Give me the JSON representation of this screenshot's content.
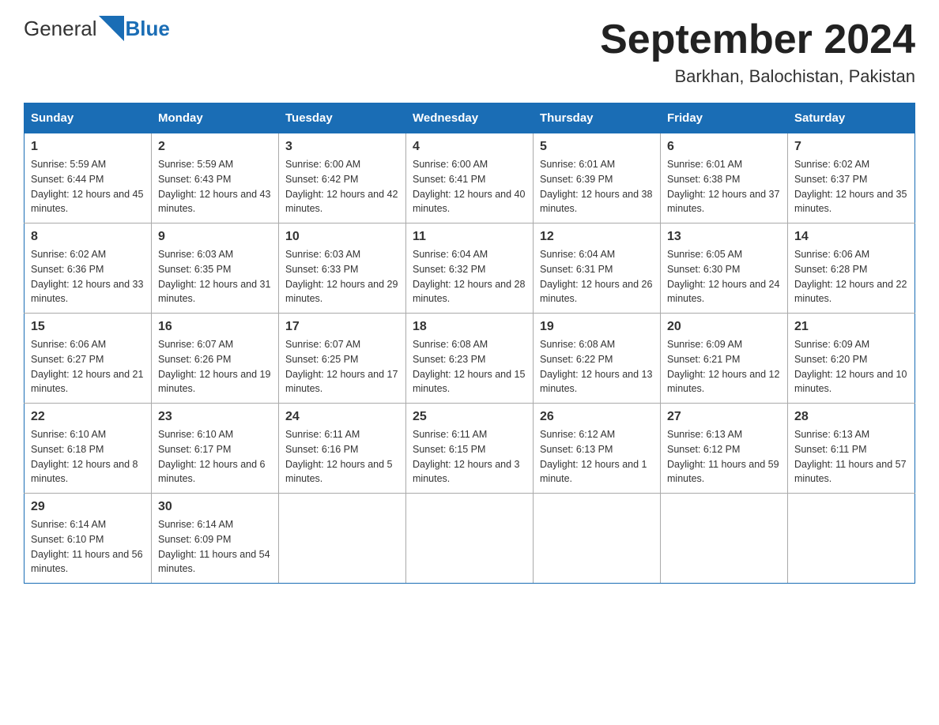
{
  "header": {
    "logo_general": "General",
    "logo_blue": "Blue",
    "month_title": "September 2024",
    "location": "Barkhan, Balochistan, Pakistan"
  },
  "weekdays": [
    "Sunday",
    "Monday",
    "Tuesday",
    "Wednesday",
    "Thursday",
    "Friday",
    "Saturday"
  ],
  "weeks": [
    [
      {
        "day": "1",
        "sunrise": "5:59 AM",
        "sunset": "6:44 PM",
        "daylight": "12 hours and 45 minutes."
      },
      {
        "day": "2",
        "sunrise": "5:59 AM",
        "sunset": "6:43 PM",
        "daylight": "12 hours and 43 minutes."
      },
      {
        "day": "3",
        "sunrise": "6:00 AM",
        "sunset": "6:42 PM",
        "daylight": "12 hours and 42 minutes."
      },
      {
        "day": "4",
        "sunrise": "6:00 AM",
        "sunset": "6:41 PM",
        "daylight": "12 hours and 40 minutes."
      },
      {
        "day": "5",
        "sunrise": "6:01 AM",
        "sunset": "6:39 PM",
        "daylight": "12 hours and 38 minutes."
      },
      {
        "day": "6",
        "sunrise": "6:01 AM",
        "sunset": "6:38 PM",
        "daylight": "12 hours and 37 minutes."
      },
      {
        "day": "7",
        "sunrise": "6:02 AM",
        "sunset": "6:37 PM",
        "daylight": "12 hours and 35 minutes."
      }
    ],
    [
      {
        "day": "8",
        "sunrise": "6:02 AM",
        "sunset": "6:36 PM",
        "daylight": "12 hours and 33 minutes."
      },
      {
        "day": "9",
        "sunrise": "6:03 AM",
        "sunset": "6:35 PM",
        "daylight": "12 hours and 31 minutes."
      },
      {
        "day": "10",
        "sunrise": "6:03 AM",
        "sunset": "6:33 PM",
        "daylight": "12 hours and 29 minutes."
      },
      {
        "day": "11",
        "sunrise": "6:04 AM",
        "sunset": "6:32 PM",
        "daylight": "12 hours and 28 minutes."
      },
      {
        "day": "12",
        "sunrise": "6:04 AM",
        "sunset": "6:31 PM",
        "daylight": "12 hours and 26 minutes."
      },
      {
        "day": "13",
        "sunrise": "6:05 AM",
        "sunset": "6:30 PM",
        "daylight": "12 hours and 24 minutes."
      },
      {
        "day": "14",
        "sunrise": "6:06 AM",
        "sunset": "6:28 PM",
        "daylight": "12 hours and 22 minutes."
      }
    ],
    [
      {
        "day": "15",
        "sunrise": "6:06 AM",
        "sunset": "6:27 PM",
        "daylight": "12 hours and 21 minutes."
      },
      {
        "day": "16",
        "sunrise": "6:07 AM",
        "sunset": "6:26 PM",
        "daylight": "12 hours and 19 minutes."
      },
      {
        "day": "17",
        "sunrise": "6:07 AM",
        "sunset": "6:25 PM",
        "daylight": "12 hours and 17 minutes."
      },
      {
        "day": "18",
        "sunrise": "6:08 AM",
        "sunset": "6:23 PM",
        "daylight": "12 hours and 15 minutes."
      },
      {
        "day": "19",
        "sunrise": "6:08 AM",
        "sunset": "6:22 PM",
        "daylight": "12 hours and 13 minutes."
      },
      {
        "day": "20",
        "sunrise": "6:09 AM",
        "sunset": "6:21 PM",
        "daylight": "12 hours and 12 minutes."
      },
      {
        "day": "21",
        "sunrise": "6:09 AM",
        "sunset": "6:20 PM",
        "daylight": "12 hours and 10 minutes."
      }
    ],
    [
      {
        "day": "22",
        "sunrise": "6:10 AM",
        "sunset": "6:18 PM",
        "daylight": "12 hours and 8 minutes."
      },
      {
        "day": "23",
        "sunrise": "6:10 AM",
        "sunset": "6:17 PM",
        "daylight": "12 hours and 6 minutes."
      },
      {
        "day": "24",
        "sunrise": "6:11 AM",
        "sunset": "6:16 PM",
        "daylight": "12 hours and 5 minutes."
      },
      {
        "day": "25",
        "sunrise": "6:11 AM",
        "sunset": "6:15 PM",
        "daylight": "12 hours and 3 minutes."
      },
      {
        "day": "26",
        "sunrise": "6:12 AM",
        "sunset": "6:13 PM",
        "daylight": "12 hours and 1 minute."
      },
      {
        "day": "27",
        "sunrise": "6:13 AM",
        "sunset": "6:12 PM",
        "daylight": "11 hours and 59 minutes."
      },
      {
        "day": "28",
        "sunrise": "6:13 AM",
        "sunset": "6:11 PM",
        "daylight": "11 hours and 57 minutes."
      }
    ],
    [
      {
        "day": "29",
        "sunrise": "6:14 AM",
        "sunset": "6:10 PM",
        "daylight": "11 hours and 56 minutes."
      },
      {
        "day": "30",
        "sunrise": "6:14 AM",
        "sunset": "6:09 PM",
        "daylight": "11 hours and 54 minutes."
      },
      null,
      null,
      null,
      null,
      null
    ]
  ],
  "labels": {
    "sunrise_prefix": "Sunrise: ",
    "sunset_prefix": "Sunset: ",
    "daylight_prefix": "Daylight: "
  }
}
